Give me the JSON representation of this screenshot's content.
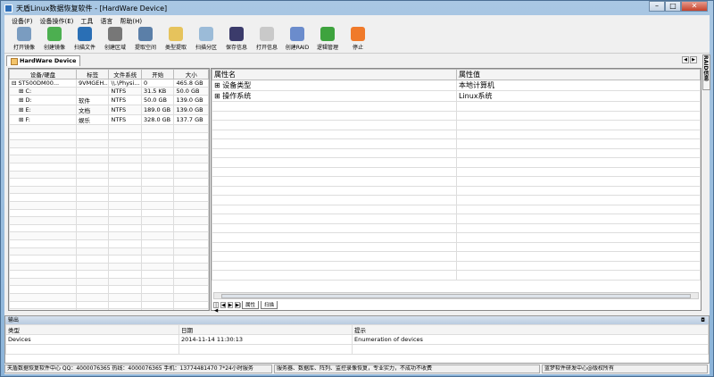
{
  "window": {
    "title": "天盾Linux数据恢复软件 - [HardWare Device]",
    "min": "–",
    "max": "□",
    "close": "✕"
  },
  "menu": [
    "设备(F)",
    "设备操作(E)",
    "工具",
    "语言",
    "帮助(H)"
  ],
  "toolbar": [
    {
      "label": "打开镜像",
      "icon": "open-image-icon",
      "color": "#7a9cc0"
    },
    {
      "label": "创建镜像",
      "icon": "create-image-icon",
      "color": "#4caf50"
    },
    {
      "label": "扫描文件",
      "icon": "scan-files-icon",
      "color": "#2a6fb5"
    },
    {
      "label": "创建区域",
      "icon": "create-region-icon",
      "color": "#777777"
    },
    {
      "label": "提取空间",
      "icon": "extract-space-icon",
      "color": "#5b7fa8"
    },
    {
      "label": "类型提取",
      "icon": "type-extract-icon",
      "color": "#e6c35c"
    },
    {
      "label": "扫描分区",
      "icon": "scan-partition-icon",
      "color": "#9bbbd8"
    },
    {
      "label": "保存信息",
      "icon": "save-info-icon",
      "color": "#3b3b6b"
    },
    {
      "label": "打开信息",
      "icon": "open-info-icon",
      "color": "#c9c9c9"
    },
    {
      "label": "创建RAID",
      "icon": "create-raid-icon",
      "color": "#6b8ccc"
    },
    {
      "label": "逻辑管理",
      "icon": "logic-manage-icon",
      "color": "#3ea33e"
    },
    {
      "label": "停止",
      "icon": "stop-icon",
      "color": "#f07a2a"
    }
  ],
  "doc_tab": "HardWare Device",
  "side_tab": "RAID信息",
  "devices": {
    "headers": [
      "设备/硬盘",
      "标签",
      "文件系统",
      "开始",
      "大小"
    ],
    "rows": [
      [
        "⊟ ST500DM00...",
        "9VMGEH...",
        "\\\\.\\Physi...",
        "0",
        "465.8 GB"
      ],
      [
        "⊞ C:",
        "",
        "NTFS",
        "31.5 KB",
        "50.0 GB"
      ],
      [
        "⊞ D:",
        "软件",
        "NTFS",
        "50.0 GB",
        "139.0 GB"
      ],
      [
        "⊞ E:",
        "文档",
        "NTFS",
        "189.0 GB",
        "139.0 GB"
      ],
      [
        "⊞ F:",
        "娱乐",
        "NTFS",
        "328.0 GB",
        "137.7 GB"
      ]
    ]
  },
  "properties": {
    "headers": [
      "属性名",
      "属性值"
    ],
    "rows": [
      [
        "⊞ 设备类型",
        "本地计算机"
      ],
      [
        "⊞ 操作系统",
        "Linux系统"
      ]
    ],
    "sheet_tabs": [
      "属性",
      "扫描"
    ]
  },
  "output": {
    "title": "输出",
    "headers": [
      "类型",
      "日期",
      "提示"
    ],
    "rows": [
      [
        "Devices",
        "2014-11-14 11:30:13",
        "Enumeration of devices"
      ]
    ]
  },
  "status": [
    "天盾数据恢复软件中心 QQ：4000076365 热线：4000076365 手机：13774481470  7*24小时服务",
    "服务器、数据库、阵列、监控录像恢复，专业实力，不成功不收费",
    "蓝梦软件研发中心@版权所有"
  ]
}
